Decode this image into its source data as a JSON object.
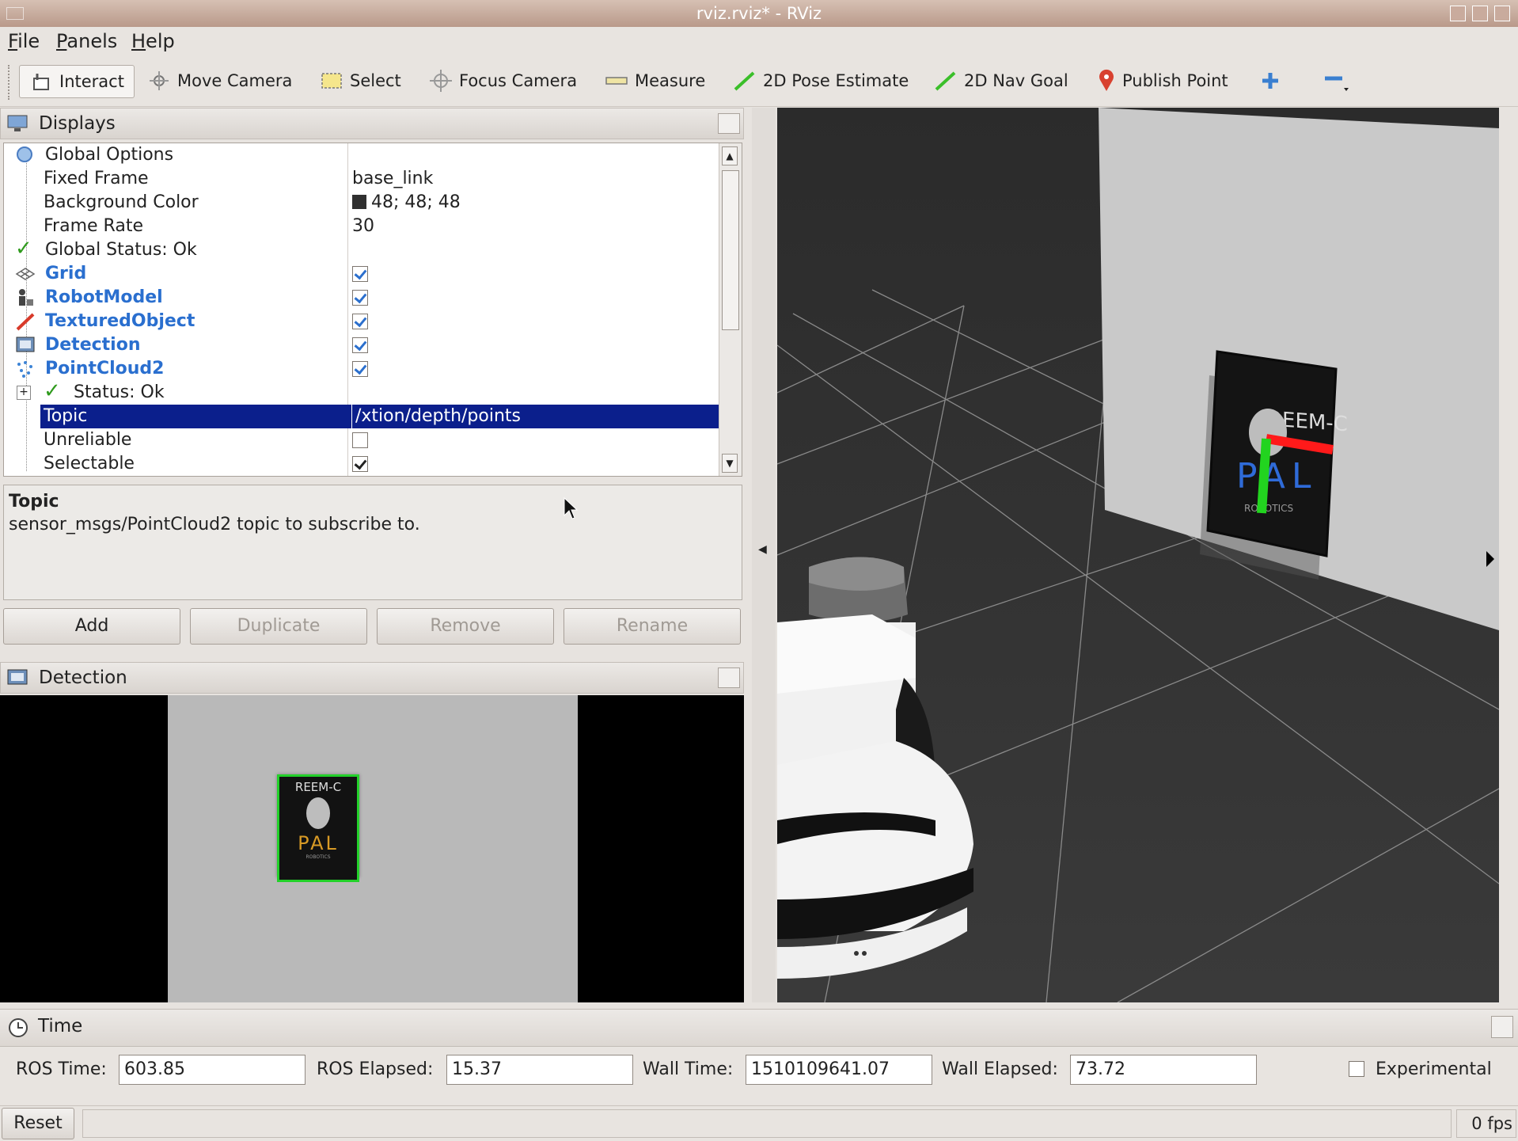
{
  "window": {
    "title": "rviz.rviz* - RViz"
  },
  "menu": {
    "file": "File",
    "panels": "Panels",
    "help": "Help"
  },
  "toolbar": {
    "interact": "Interact",
    "move_camera": "Move Camera",
    "select": "Select",
    "focus_camera": "Focus Camera",
    "measure": "Measure",
    "pose_estimate": "2D Pose Estimate",
    "nav_goal": "2D Nav Goal",
    "publish_point": "Publish Point"
  },
  "displays_panel": {
    "title": "Displays",
    "rows": [
      {
        "name": "Global Options",
        "value": ""
      },
      {
        "name": "Fixed Frame",
        "value": "base_link"
      },
      {
        "name": "Background Color",
        "value": "48; 48; 48"
      },
      {
        "name": "Frame Rate",
        "value": "30"
      },
      {
        "name": "Global Status: Ok",
        "value": ""
      },
      {
        "name": "Grid",
        "value": ""
      },
      {
        "name": "RobotModel",
        "value": ""
      },
      {
        "name": "TexturedObject",
        "value": ""
      },
      {
        "name": "Detection",
        "value": ""
      },
      {
        "name": "PointCloud2",
        "value": ""
      },
      {
        "name": "Status: Ok",
        "value": ""
      },
      {
        "name": "Topic",
        "value": "/xtion/depth/points"
      },
      {
        "name": "Unreliable",
        "value": ""
      },
      {
        "name": "Selectable",
        "value": ""
      }
    ],
    "checks": {
      "grid": true,
      "robot_model": true,
      "textured_object": true,
      "detection": true,
      "pointcloud2": true,
      "unreliable": false,
      "selectable": true
    },
    "background_swatch": "#303030"
  },
  "description": {
    "title": "Topic",
    "text": "sensor_msgs/PointCloud2 topic to subscribe to."
  },
  "buttons": {
    "add": "Add",
    "duplicate": "Duplicate",
    "remove": "Remove",
    "rename": "Rename"
  },
  "detection_panel": {
    "title": "Detection",
    "poster_title": "REEM-C",
    "poster_brand": "PAL",
    "poster_sub": "ROBOTICS"
  },
  "view3d": {
    "poster_title": "REEM-C",
    "poster_brand": "PAL",
    "poster_sub": "ROBOTICS"
  },
  "time_panel": {
    "title": "Time",
    "ros_time_label": "ROS Time:",
    "ros_time": "603.85",
    "ros_elapsed_label": "ROS Elapsed:",
    "ros_elapsed": "15.37",
    "wall_time_label": "Wall Time:",
    "wall_time": "1510109641.07",
    "wall_elapsed_label": "Wall Elapsed:",
    "wall_elapsed": "73.72",
    "experimental": "Experimental",
    "experimental_checked": false
  },
  "statusbar": {
    "reset": "Reset",
    "fps": "0 fps"
  }
}
